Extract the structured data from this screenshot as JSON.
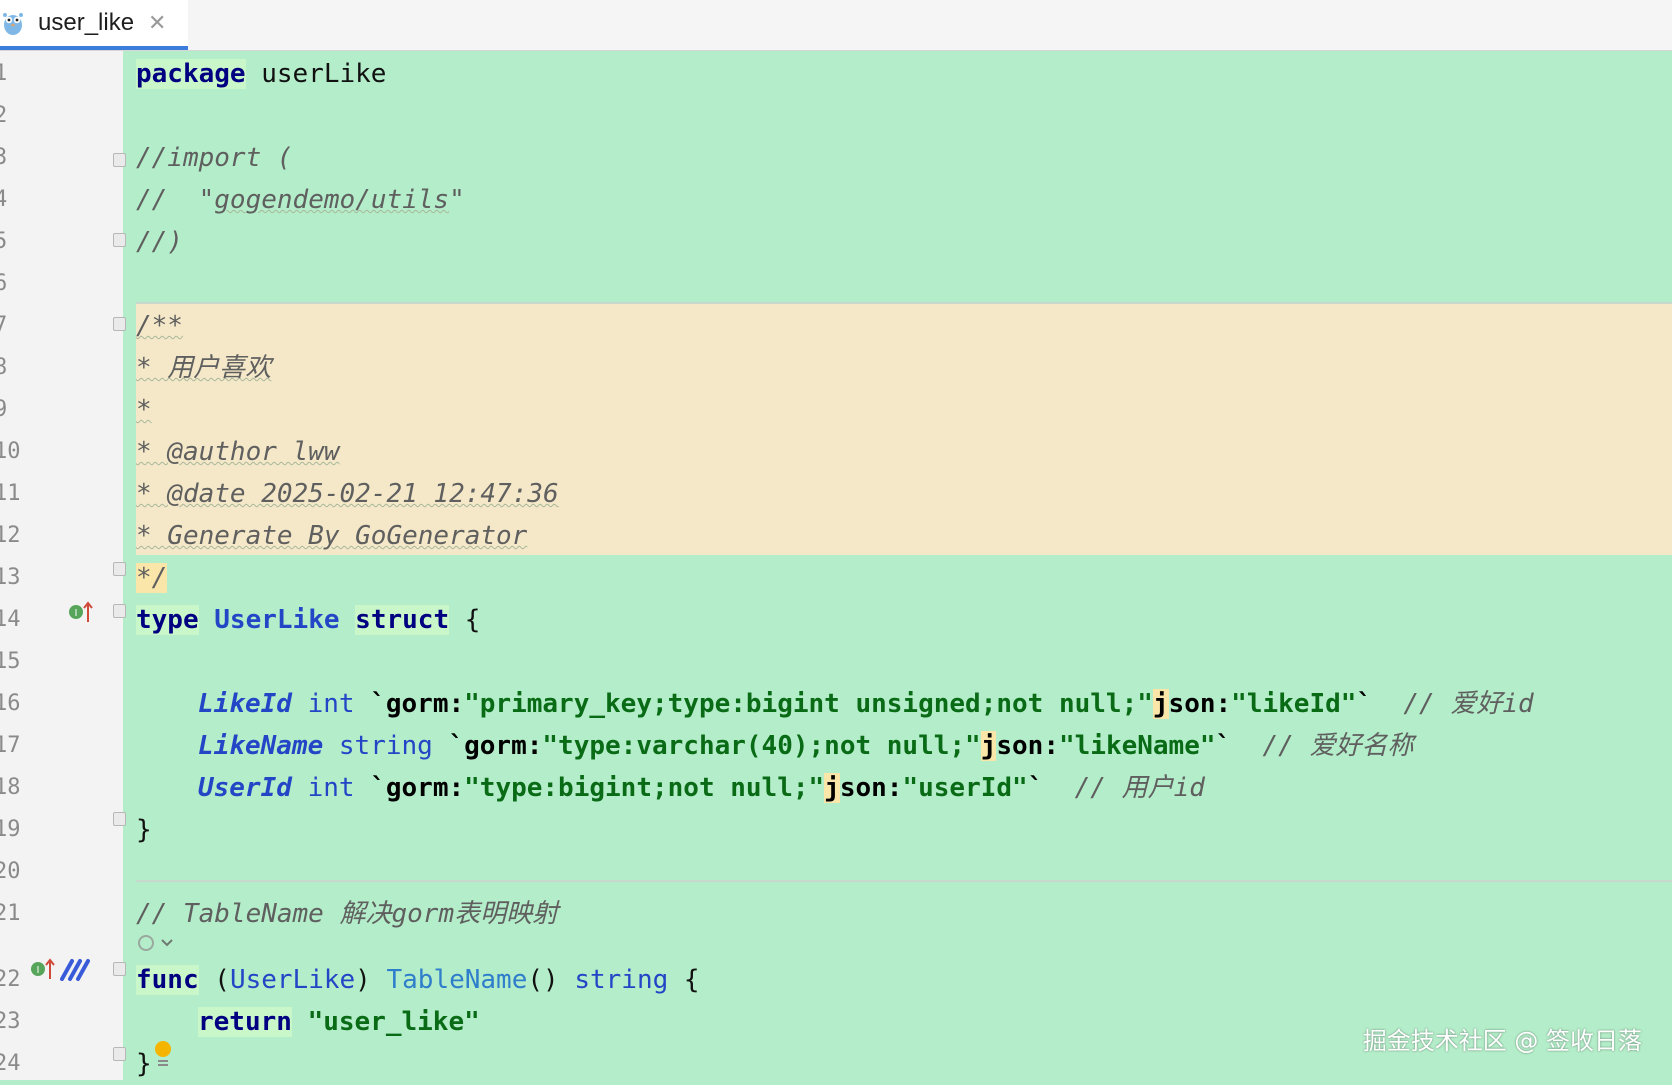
{
  "tab": {
    "label": "user_like",
    "close_glyph": "✕",
    "icon": "gopher-icon"
  },
  "colors": {
    "editor_bg": "#b4edc9",
    "doc_bg": "#f4e8c8",
    "keyword": "#000080",
    "type": "#2346c7",
    "string": "#0a6b16",
    "comment": "#5f5f5f",
    "tab_accent": "#3c7ddb"
  },
  "lines": [
    {
      "n": "1"
    },
    {
      "n": "2"
    },
    {
      "n": "3"
    },
    {
      "n": "4"
    },
    {
      "n": "5"
    },
    {
      "n": "6"
    },
    {
      "n": "7"
    },
    {
      "n": "8"
    },
    {
      "n": "9"
    },
    {
      "n": "10"
    },
    {
      "n": "11"
    },
    {
      "n": "12"
    },
    {
      "n": "13"
    },
    {
      "n": "14"
    },
    {
      "n": "15"
    },
    {
      "n": "16"
    },
    {
      "n": "17"
    },
    {
      "n": "18"
    },
    {
      "n": "19"
    },
    {
      "n": "20"
    },
    {
      "n": "21"
    },
    {
      "n": "22"
    },
    {
      "n": "23"
    },
    {
      "n": "24"
    }
  ],
  "code": {
    "l1_kw": "package",
    "l1_name": " userLike",
    "l3": "//import (",
    "l4a": "//  \"",
    "l4b": "gogendemo/utils",
    "l4c": "\"",
    "l5": "//)",
    "l7": "/**",
    "l8": "* 用户喜欢",
    "l9": "*",
    "l10": "* @author lww",
    "l11": "* @date 2025-02-21 12:47:36",
    "l12": "* Generate By GoGenerator",
    "l13": "*/",
    "l14_type": "type",
    "l14_name": "UserLike",
    "l14_struct": "struct",
    "l14_brace": " {",
    "f1_name": "LikeId",
    "f1_type": "int",
    "f1_tick": "`",
    "f1_gorm": "gorm:",
    "f1_val": "\"primary_key;type:bigint unsigned;not null;\"",
    "f1_j": "j",
    "f1_son": "son:",
    "f1_jval": "\"likeId\"",
    "f1_end": "`",
    "f1_cm": "// 爱好id",
    "f2_name": "LikeName",
    "f2_type": "string",
    "f2_tick": "`",
    "f2_gorm": "gorm:",
    "f2_val": "\"type:varchar(40);not null;\"",
    "f2_j": "j",
    "f2_son": "son:",
    "f2_jval": "\"likeName\"",
    "f2_end": "`",
    "f2_cm": "// 爱好名称",
    "f3_name": "UserId",
    "f3_type": "int",
    "f3_tick": "`",
    "f3_gorm": "gorm:",
    "f3_val": "\"type:bigint;not null;\"",
    "f3_j": "j",
    "f3_son": "son:",
    "f3_jval": "\"userId\"",
    "f3_end": "`",
    "f3_cm": "// 用户id",
    "l19": "}",
    "l21": "// TableName 解决gorm表明映射",
    "l22_func": "func",
    "l22_open": " (",
    "l22_recv": "UserLike",
    "l22_close": ") ",
    "l22_fn": "TableName",
    "l22_parens": "() ",
    "l22_ret": "string",
    "l22_brace": " {",
    "l23_ret": "return",
    "l23_str": "\"user_like\"",
    "l24": "}"
  },
  "watermark": "掘金技术社区 @ 签收日落"
}
